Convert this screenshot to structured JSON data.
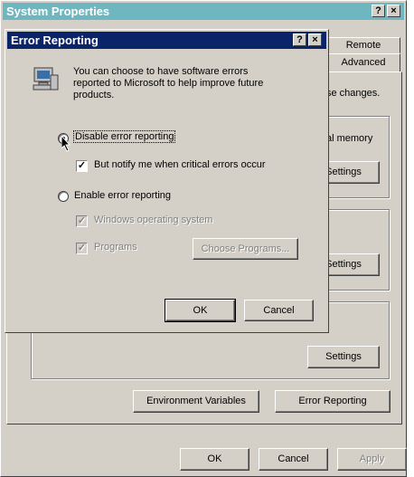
{
  "system_properties": {
    "title": "System Properties",
    "help_btn": "?",
    "close_btn": "×",
    "tabs": [
      {
        "label": "Remote"
      },
      {
        "label": "Advanced"
      }
    ],
    "partial_text_changes": "se changes.",
    "partial_text_memory": "al memory",
    "settings_1": "Settings",
    "settings_2": "Settings",
    "settings_3": "Settings",
    "env_vars_button": "Environment Variables",
    "error_reporting_button": "Error Reporting",
    "ok_button": "OK",
    "cancel_button": "Cancel",
    "apply_button": "Apply"
  },
  "error_reporting": {
    "title": "Error Reporting",
    "help_btn": "?",
    "close_btn": "×",
    "description_line1": "You can choose to have software errors",
    "description_line2": "reported to Microsoft to help improve future",
    "description_line3": "products.",
    "disable_label": "Disable error reporting",
    "notify_label": "But notify me when critical errors occur",
    "enable_label": "Enable error reporting",
    "windows_os_label": "Windows operating system",
    "programs_label": "Programs",
    "choose_programs_button": "Choose Programs...",
    "ok_button": "OK",
    "cancel_button": "Cancel",
    "disable_selected": true,
    "notify_checked": true
  },
  "colors": {
    "titlebar_active": "#0a246a",
    "titlebar_inactive": "#808080",
    "watermark": "#1aa9b6"
  }
}
